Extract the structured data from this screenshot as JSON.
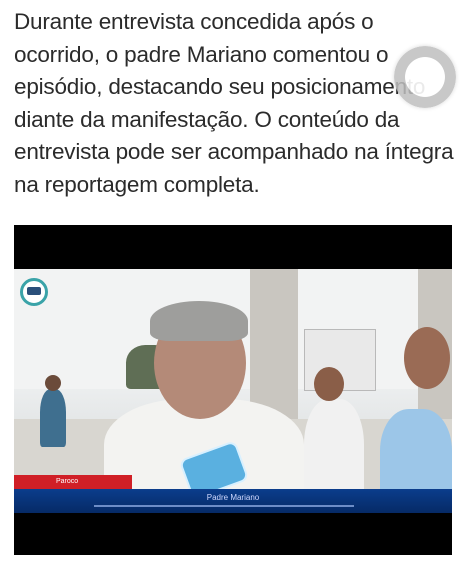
{
  "article": {
    "lines": [
      "Durante entrevista concedida após o",
      "ocorrido, o padre Mariano comentou o",
      "episódio, destacando seu posicionamento",
      "diante da manifestação. O conteúdo da",
      "entrevista pode ser acompanhado na íntegra",
      "na reportagem completa."
    ]
  },
  "video": {
    "lower_third_left": "Paroco",
    "lower_third_name": "Padre Mariano"
  },
  "icons": {
    "loader": "loading-spinner-icon",
    "channel_logo": "tv-channel-logo-icon",
    "microphone": "microphone-icon"
  },
  "colors": {
    "text": "#2b2b2b",
    "lower_third_red": "#d01f26",
    "lower_third_blue": "#0b3d8c"
  }
}
